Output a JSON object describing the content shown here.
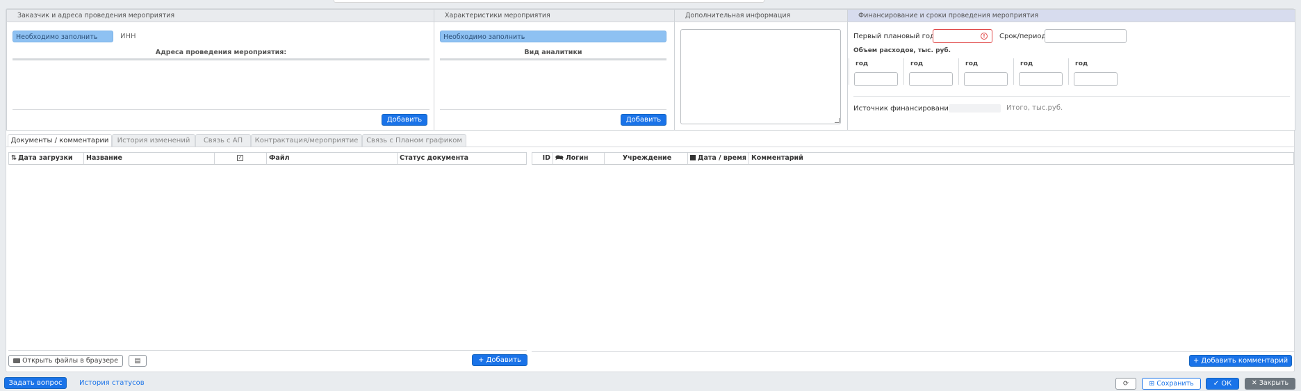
{
  "panels": {
    "customer": {
      "title": "Заказчик и адреса проведения мероприятия",
      "required_text": "Необходимо заполнить",
      "inn_label": "ИНН",
      "addresses_label": "Адреса проведения мероприятия:",
      "add_label": "Добавить"
    },
    "characteristics": {
      "title": "Характеристики мероприятия",
      "required_text": "Необходимо заполнить",
      "analytics_label": "Вид аналитики",
      "add_label": "Добавить"
    },
    "additional": {
      "title": "Дополнительная информация"
    },
    "financing": {
      "title": "Финансирование и сроки проведения мероприятия",
      "first_year_label": "Первый плановый год",
      "period_label": "Срок/период",
      "volume_label": "Объем расходов, тыс. руб.",
      "years": [
        "год",
        "год",
        "год",
        "год",
        "год"
      ],
      "source_label": "Источник финансирования",
      "total_label": "Итого, тыс.руб."
    }
  },
  "tabs": [
    {
      "label": "Документы / комментарии",
      "active": true
    },
    {
      "label": "История изменений",
      "active": false
    },
    {
      "label": "Связь с АП",
      "active": false
    },
    {
      "label": "Контрактация/мероприятие",
      "active": false
    },
    {
      "label": "Связь с Планом графиком",
      "active": false
    }
  ],
  "documents_grid": {
    "sort_icon": "sort-icon",
    "columns": [
      "Дата загрузки",
      "Название",
      "Файл",
      "Статус документа"
    ],
    "open_files_label": "Открыть файлы в браузере",
    "add_label": "Добавить"
  },
  "comments_grid": {
    "columns": [
      "ID",
      "Логин",
      "Учреждение",
      "Дата / время",
      "Комментарий"
    ],
    "add_comment_label": "Добавить комментарий"
  },
  "footer": {
    "ask_label": "Задать вопрос",
    "history_label": "История статусов",
    "save_label": "Сохранить",
    "ok_label": "ОК",
    "close_label": "Закрыть"
  },
  "colors": {
    "accent": "#1a73e8",
    "required_fill": "#8ec1f2",
    "error": "#e04848"
  }
}
